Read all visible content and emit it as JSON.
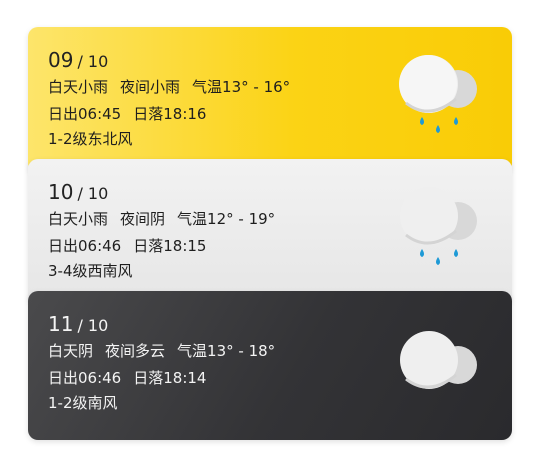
{
  "days": [
    {
      "day": "09",
      "month_sep": "/ 10",
      "daytime": "白天小雨",
      "night": "夜间小雨",
      "temperature": "气温13° - 16°",
      "sunrise": "日出06:45",
      "sunset": "日落18:16",
      "wind": "1-2级东北风",
      "icon": "cloud-rain-icon"
    },
    {
      "day": "10",
      "month_sep": "/ 10",
      "daytime": "白天小雨",
      "night": "夜间阴",
      "temperature": "气温12° - 19°",
      "sunrise": "日出06:46",
      "sunset": "日落18:15",
      "wind": "3-4级西南风",
      "icon": "cloud-rain-icon"
    },
    {
      "day": "11",
      "month_sep": "/ 10",
      "daytime": "白天阴",
      "night": "夜间多云",
      "temperature": "气温13° - 18°",
      "sunrise": "日出06:46",
      "sunset": "日落18:14",
      "wind": "1-2级南风",
      "icon": "cloud-icon"
    }
  ],
  "colors": {
    "yellow": "#fbd315",
    "gray": "#e9e9e9",
    "dark": "#333336",
    "rain": "#1e9ad6"
  }
}
